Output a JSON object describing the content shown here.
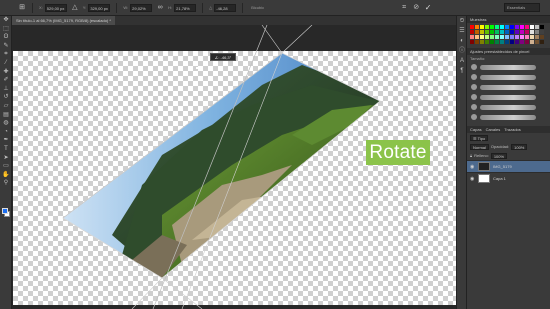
{
  "options_bar": {
    "fields": [
      {
        "label": "X:",
        "value": "529,00 px"
      },
      {
        "label": "Y:",
        "value": "329,00 px"
      },
      {
        "label": "W:",
        "value": "29,02%"
      },
      {
        "label": "H:",
        "value": "21,78%"
      },
      {
        "label": "△",
        "value": "-46,28"
      }
    ],
    "interp_label": "Bicubic",
    "workspace": "Essentials"
  },
  "document": {
    "tab_title": "Sin título-1 al 66,7% (IMG_5179, RGB/8) (escalado) *",
    "transform_readout": "∠: -46,3°",
    "overlay_label": "Rotate"
  },
  "tools": [
    "move",
    "marquee",
    "lasso",
    "quick-select",
    "crop",
    "eyedropper",
    "healing",
    "brush",
    "stamp",
    "history-brush",
    "eraser",
    "gradient",
    "blur",
    "dodge",
    "pen",
    "type",
    "path-select",
    "shape",
    "hand",
    "zoom"
  ],
  "panels": {
    "swatches_title": "Muestras",
    "brushes_tabs": [
      "Ajustes preestablecidos de pincel"
    ],
    "brush_size_label": "Tamaño:",
    "layers_tabs": [
      "Capas",
      "Canales",
      "Trazados"
    ],
    "blend_mode": "Normal",
    "opacity_label": "Opacidad:",
    "opacity_value": "100%",
    "fill_label": "Relleno:",
    "fill_value": "100%",
    "layers": [
      {
        "name": "IMG_5179",
        "active": true
      },
      {
        "name": "Capa 1",
        "active": false
      }
    ]
  },
  "swatch_colors": [
    "#ff0000",
    "#ff8000",
    "#ffff00",
    "#80ff00",
    "#00ff00",
    "#00ff80",
    "#00ffff",
    "#0080ff",
    "#0000ff",
    "#8000ff",
    "#ff00ff",
    "#ff0080",
    "#ffffff",
    "#c0c0c0",
    "#000000",
    "#c00000",
    "#c06000",
    "#c0c000",
    "#60c000",
    "#00c000",
    "#00c060",
    "#00c0c0",
    "#0060c0",
    "#0000c0",
    "#6000c0",
    "#c000c0",
    "#c00060",
    "#e0e0e0",
    "#808080",
    "#404040",
    "#ff8080",
    "#ffc080",
    "#ffff80",
    "#c0ff80",
    "#80ff80",
    "#80ffc0",
    "#80ffff",
    "#80c0ff",
    "#8080ff",
    "#c080ff",
    "#ff80ff",
    "#ff80c0",
    "#f0d8b0",
    "#a08060",
    "#604020",
    "#800000",
    "#804000",
    "#808000",
    "#408000",
    "#008000",
    "#008040",
    "#008080",
    "#004080",
    "#000080",
    "#400080",
    "#800080",
    "#800040",
    "#d0b090",
    "#705030",
    "#302010"
  ]
}
